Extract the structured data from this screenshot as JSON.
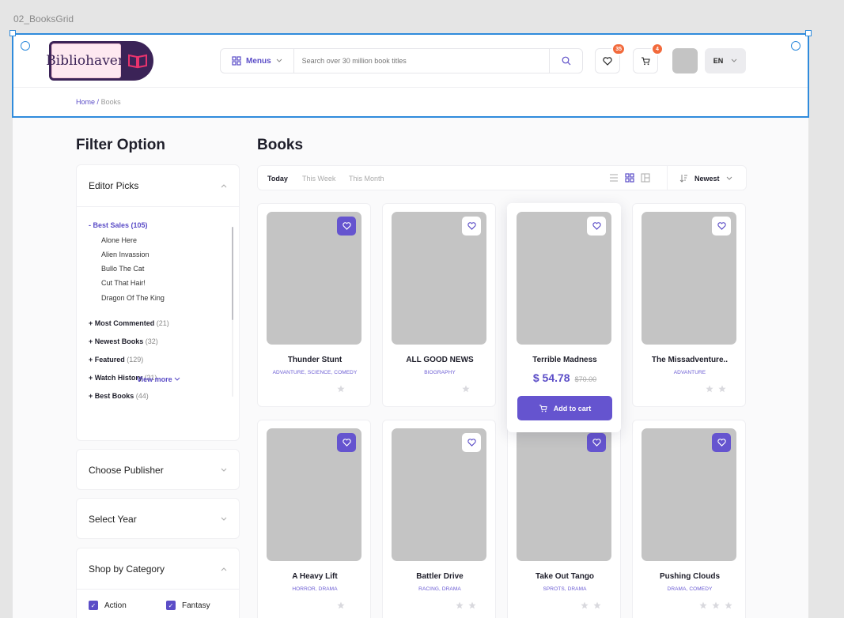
{
  "frame_label": "02_BooksGrid",
  "header": {
    "logo_text": "Bibliohaven",
    "menus_label": "Menus",
    "search_placeholder": "Search over 30 million book titles",
    "wishlist_count": "35",
    "cart_count": "4",
    "language": "EN"
  },
  "breadcrumb": {
    "home": "Home",
    "separator": "/",
    "current": "Books"
  },
  "filter": {
    "heading": "Filter Option",
    "editor_picks": {
      "title": "Editor Picks",
      "best_sales": "- Best Sales (105)",
      "best_sales_items": [
        "Alone Here",
        "Alien Invassion",
        "Bullo The Cat",
        "Cut That Hair!",
        "Dragon Of The King"
      ],
      "groups": [
        {
          "label": "+ Most Commented",
          "count": "(21)"
        },
        {
          "label": "+ Newest Books",
          "count": "(32)"
        },
        {
          "label": "+ Featured",
          "count": "(129)"
        },
        {
          "label": "+ Watch History",
          "count": "(21)"
        },
        {
          "label": "+ Best Books",
          "count": "(44)"
        }
      ],
      "view_more": "View more"
    },
    "publisher": "Choose Publisher",
    "year": "Select Year",
    "category": {
      "title": "Shop by Category",
      "options": [
        "Action",
        "Fantasy"
      ]
    }
  },
  "books": {
    "heading": "Books",
    "tabs": [
      "Today",
      "This Week",
      "This Month"
    ],
    "sort_label": "Newest",
    "items": [
      {
        "title": "Thunder Stunt",
        "genres": "ADVANTURE, SCIENCE, COMEDY",
        "rating": 1,
        "favorited": true
      },
      {
        "title": "ALL GOOD NEWS",
        "genres": "BIOGRAPHY",
        "rating": 1,
        "favorited": false
      },
      {
        "title": "Terrible Madness",
        "genres": "",
        "price": "$ 54.78",
        "old_price": "$70.00",
        "cta": "Add to cart",
        "favorited": false
      },
      {
        "title": "The Missadventure..",
        "genres": "ADVANTURE",
        "rating": 2,
        "favorited": false
      },
      {
        "title": "A Heavy Lift",
        "genres": "HORROR, DRAMA",
        "rating": 1,
        "favorited": true
      },
      {
        "title": "Battler Drive",
        "genres": "RACING, DRAMA",
        "rating": 2,
        "favorited": false
      },
      {
        "title": "Take Out Tango",
        "genres": "SPROTS, DRAMA",
        "rating": 2,
        "favorited": true
      },
      {
        "title": "Pushing Clouds",
        "genres": "DRAMA, COMEDY",
        "rating": 3,
        "favorited": true
      }
    ]
  },
  "colors": {
    "accent": "#5b4dc7",
    "badge": "#f26a3c",
    "logo_bg": "#3b2357",
    "selection": "#2f8bdc"
  }
}
